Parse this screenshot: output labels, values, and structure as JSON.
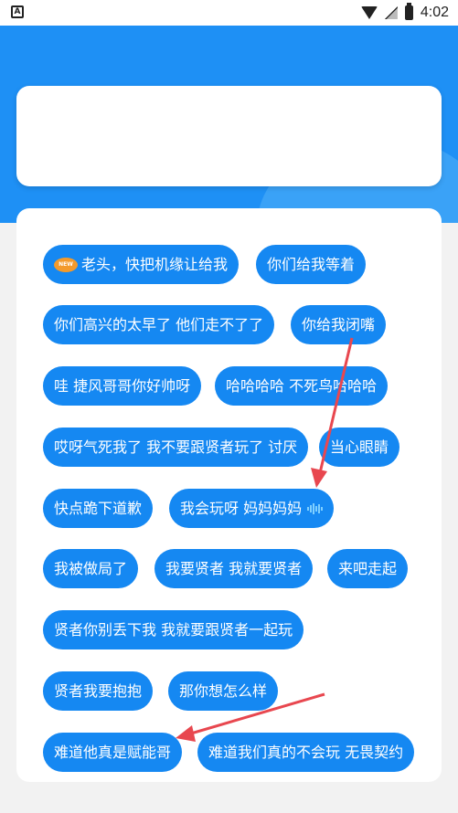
{
  "status_bar": {
    "left_icon": "A",
    "time": "4:02",
    "icons": [
      "wifi-icon",
      "no-signal-icon",
      "battery-charging-icon"
    ]
  },
  "colors": {
    "header": "#1e90f5",
    "chip": "#1588f2",
    "annotation_arrow": "#e8474f"
  },
  "chips": [
    {
      "label": "老头，快把机缘让给我",
      "badge": "NEW"
    },
    {
      "label": "你们给我等着"
    },
    {
      "label": "你们高兴的太早了 他们走不了了"
    },
    {
      "label": "你给我闭嘴"
    },
    {
      "label": "哇 捷风哥哥你好帅呀"
    },
    {
      "label": "哈哈哈哈 不死鸟哈哈哈"
    },
    {
      "label": "哎呀气死我了 我不要跟贤者玩了 讨厌"
    },
    {
      "label": "当心眼睛"
    },
    {
      "label": "快点跪下道歉"
    },
    {
      "label": "我会玩呀  妈妈妈妈",
      "icon": "sound-wave-icon"
    },
    {
      "label": "我被做局了"
    },
    {
      "label": "我要贤者 我就要贤者"
    },
    {
      "label": "来吧走起"
    },
    {
      "label": "贤者你别丢下我  我就要跟贤者一起玩"
    },
    {
      "label": "贤者我要抱抱"
    },
    {
      "label": "那你想怎么样"
    },
    {
      "label": "难道他真是赋能哥"
    },
    {
      "label": "难道我们真的不会玩  无畏契约"
    }
  ]
}
